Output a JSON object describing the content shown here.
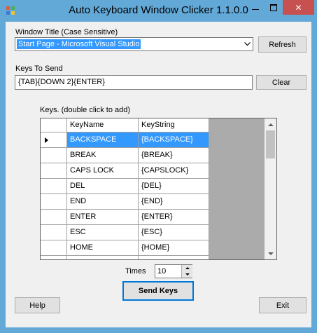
{
  "window": {
    "title": "Auto Keyboard Window Clicker 1.1.0.0",
    "icons": {
      "app": "app-icon",
      "minimize": "minimize-icon",
      "maximize": "maximize-icon",
      "close": "close-icon"
    },
    "close_glyph": "✕"
  },
  "window_title_section": {
    "label": "Window Title (Case Sensitive)",
    "selected": "Start Page - Microsoft Visual Studio",
    "refresh_label": "Refresh"
  },
  "keys_to_send": {
    "label": "Keys To Send",
    "value": "{TAB}{DOWN 2}{ENTER}",
    "clear_label": "Clear"
  },
  "keys_grid": {
    "label": "Keys. (double click to add)",
    "columns": [
      "KeyName",
      "KeyString"
    ],
    "rows": [
      [
        "BACKSPACE",
        "{BACKSPACE}"
      ],
      [
        "BREAK",
        "{BREAK}"
      ],
      [
        "CAPS LOCK",
        "{CAPSLOCK}"
      ],
      [
        "DEL",
        "{DEL}"
      ],
      [
        "END",
        "{END}"
      ],
      [
        "ENTER",
        "{ENTER}"
      ],
      [
        "ESC",
        "{ESC}"
      ],
      [
        "HOME",
        "{HOME}"
      ]
    ],
    "selected_row": 0
  },
  "times": {
    "label": "Times",
    "value": "10"
  },
  "buttons": {
    "send": "Send Keys",
    "help": "Help",
    "exit": "Exit"
  },
  "colors": {
    "titlebar": "#63a9d8",
    "selection": "#3399ff",
    "close": "#c75050",
    "default_button_border": "#0078d7"
  }
}
